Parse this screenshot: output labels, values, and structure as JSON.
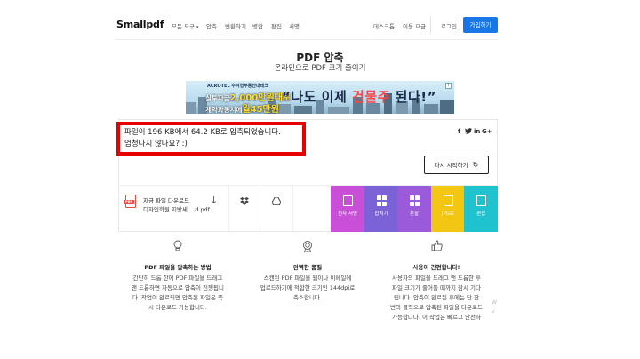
{
  "header": {
    "logo": "Smallpdf",
    "nav": [
      {
        "label": "모든 도구"
      },
      {
        "label": "압축"
      },
      {
        "label": "변환하기"
      },
      {
        "label": "병합"
      },
      {
        "label": "편집"
      },
      {
        "label": "서명"
      }
    ],
    "right_nav": [
      {
        "label": "데스크톱"
      },
      {
        "label": "이용 요금"
      },
      {
        "label": "로그인"
      }
    ],
    "signup": "가입하기"
  },
  "page": {
    "title": "PDF 압축",
    "subtitle": "온라인으로 PDF 크기 줄이기"
  },
  "ad": {
    "brand": "ACROTEL 수익형부동산대테크",
    "line1_a": "실투자금",
    "line1_b": "2,000만원대로",
    "line2_a": "계약과동시에",
    "line2_b": "월45만원",
    "quote_a": "“나도 이제 ",
    "quote_hl": "건물주",
    "quote_b": " 된다!”"
  },
  "result": {
    "line1": "파일이 196 KB에서 64.2 KB로 압축되었습니다.",
    "line2": "엄청나지 않나요? :)",
    "social": [
      "f",
      "t",
      "in",
      "G+"
    ],
    "restart_label": "다시 시작하기",
    "download_label": "지금 파일 다운로드",
    "file_name": "디자인학원 지방세...",
    "file_ext": "d.pdf",
    "file_badge": "PDF"
  },
  "tiles": [
    {
      "label": "전자 서명",
      "color": "#c94fd8"
    },
    {
      "label": "합치기",
      "color": "#7b62d6"
    },
    {
      "label": "분할",
      "color": "#9b5ad9"
    },
    {
      "label": "JPG로",
      "color": "#f2c613"
    },
    {
      "label": "편집",
      "color": "#1fc2cf"
    }
  ],
  "features": [
    {
      "title": "PDF 파일을 압축하는 방법",
      "body": [
        "간단히 드롭 한에 PDF 파일을 드래그",
        "앤 드롭하면 자동으로 압축이 진행됩니",
        "다. 작업이 완료되면 압축된 파일은 즉",
        "시 다운로드 가능합니다."
      ]
    },
    {
      "title": "완벽한 품질",
      "body": [
        "스캔된 PDF 파일을 웹이나 이메일에",
        "업로드하기에 적합한 크기인 144dpi로",
        "축소합니다."
      ]
    },
    {
      "title": "사용이 간편합니다!",
      "body": [
        "사용자의 파일을 드래그 앤 드롭한 후",
        "파일 크기가 줄어들 때까지 잠시 기다",
        "립니다. 압축이 완료된 후에는 단 한",
        "번의 클릭으로 압축된 파일을 다운로드",
        "가능합니다. 이 작업은 빠르고 안전하"
      ]
    }
  ],
  "side_text": [
    "W",
    "v"
  ]
}
